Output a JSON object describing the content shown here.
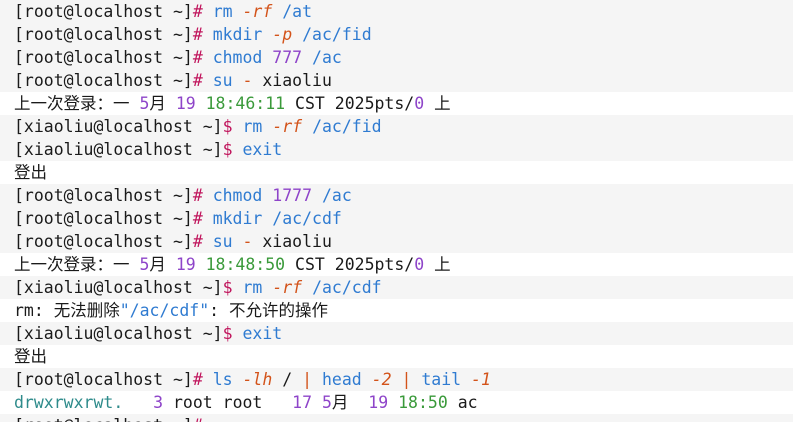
{
  "colors": {
    "background": "#ffffff",
    "prompt_bar": "#f5f5f5",
    "text": "#1a1a1a",
    "prompt_hash": "#c0155c",
    "prompt_dollar": "#c0155c",
    "command": "#2f7bd1",
    "flag": "#d3531a",
    "number": "#8e44c9",
    "time": "#3a9a3a",
    "perm": "#2e8b8b",
    "cursor": "#f2b705"
  },
  "lines": [
    {
      "kind": "cmd",
      "spans": [
        {
          "t": "[root@localhost ~]",
          "c": "text"
        },
        {
          "t": "# ",
          "c": "prompt_hash"
        },
        {
          "t": "rm ",
          "c": "command"
        },
        {
          "t": "-rf ",
          "c": "flag",
          "i": true
        },
        {
          "t": "/at",
          "c": "command"
        }
      ]
    },
    {
      "kind": "cmd",
      "spans": [
        {
          "t": "[root@localhost ~]",
          "c": "text"
        },
        {
          "t": "# ",
          "c": "prompt_hash"
        },
        {
          "t": "mkdir ",
          "c": "command"
        },
        {
          "t": "-p ",
          "c": "flag",
          "i": true
        },
        {
          "t": "/ac/fid",
          "c": "command"
        }
      ]
    },
    {
      "kind": "cmd",
      "spans": [
        {
          "t": "[root@localhost ~]",
          "c": "text"
        },
        {
          "t": "# ",
          "c": "prompt_hash"
        },
        {
          "t": "chmod ",
          "c": "command"
        },
        {
          "t": "777 ",
          "c": "number"
        },
        {
          "t": "/ac",
          "c": "command"
        }
      ]
    },
    {
      "kind": "cmd",
      "spans": [
        {
          "t": "[root@localhost ~]",
          "c": "text"
        },
        {
          "t": "# ",
          "c": "prompt_hash"
        },
        {
          "t": "su ",
          "c": "command"
        },
        {
          "t": "- ",
          "c": "flag"
        },
        {
          "t": "xiaoliu",
          "c": "text"
        }
      ]
    },
    {
      "kind": "out",
      "spans": [
        {
          "t": "上一次登录：一 ",
          "c": "text"
        },
        {
          "t": "5",
          "c": "number"
        },
        {
          "t": "月 ",
          "c": "text"
        },
        {
          "t": "19 ",
          "c": "number"
        },
        {
          "t": "18:46:11 ",
          "c": "time"
        },
        {
          "t": "CST 2025pts/",
          "c": "text"
        },
        {
          "t": "0",
          "c": "number"
        },
        {
          "t": " 上",
          "c": "text"
        }
      ]
    },
    {
      "kind": "cmd",
      "spans": [
        {
          "t": "[xiaoliu@localhost ~]",
          "c": "text"
        },
        {
          "t": "$ ",
          "c": "prompt_dollar"
        },
        {
          "t": "rm ",
          "c": "command"
        },
        {
          "t": "-rf ",
          "c": "flag",
          "i": true
        },
        {
          "t": "/ac/fid",
          "c": "command"
        }
      ]
    },
    {
      "kind": "cmd",
      "spans": [
        {
          "t": "[xiaoliu@localhost ~]",
          "c": "text"
        },
        {
          "t": "$ ",
          "c": "prompt_dollar"
        },
        {
          "t": "exit",
          "c": "command"
        }
      ]
    },
    {
      "kind": "out",
      "spans": [
        {
          "t": "登出",
          "c": "text"
        }
      ]
    },
    {
      "kind": "cmd",
      "spans": [
        {
          "t": "[root@localhost ~]",
          "c": "text"
        },
        {
          "t": "# ",
          "c": "prompt_hash"
        },
        {
          "t": "chmod ",
          "c": "command"
        },
        {
          "t": "1777 ",
          "c": "number"
        },
        {
          "t": "/ac",
          "c": "command"
        }
      ]
    },
    {
      "kind": "cmd",
      "spans": [
        {
          "t": "[root@localhost ~]",
          "c": "text"
        },
        {
          "t": "# ",
          "c": "prompt_hash"
        },
        {
          "t": "mkdir ",
          "c": "command"
        },
        {
          "t": "/ac/cdf",
          "c": "command"
        }
      ]
    },
    {
      "kind": "cmd",
      "spans": [
        {
          "t": "[root@localhost ~]",
          "c": "text"
        },
        {
          "t": "# ",
          "c": "prompt_hash"
        },
        {
          "t": "su ",
          "c": "command"
        },
        {
          "t": "- ",
          "c": "flag"
        },
        {
          "t": "xiaoliu",
          "c": "text"
        }
      ]
    },
    {
      "kind": "out",
      "spans": [
        {
          "t": "上一次登录：一 ",
          "c": "text"
        },
        {
          "t": "5",
          "c": "number"
        },
        {
          "t": "月 ",
          "c": "text"
        },
        {
          "t": "19 ",
          "c": "number"
        },
        {
          "t": "18:48:50 ",
          "c": "time"
        },
        {
          "t": "CST 2025pts/",
          "c": "text"
        },
        {
          "t": "0",
          "c": "number"
        },
        {
          "t": " 上",
          "c": "text"
        }
      ]
    },
    {
      "kind": "cmd",
      "spans": [
        {
          "t": "[xiaoliu@localhost ~]",
          "c": "text"
        },
        {
          "t": "$ ",
          "c": "prompt_dollar"
        },
        {
          "t": "rm ",
          "c": "command"
        },
        {
          "t": "-rf ",
          "c": "flag",
          "i": true
        },
        {
          "t": "/ac/cdf",
          "c": "command"
        }
      ]
    },
    {
      "kind": "out",
      "spans": [
        {
          "t": "rm",
          "c": "text"
        },
        {
          "t": ": 无法删除",
          "c": "text"
        },
        {
          "t": "\"/ac/cdf\"",
          "c": "command"
        },
        {
          "t": ": 不允许的操作",
          "c": "text"
        }
      ]
    },
    {
      "kind": "cmd",
      "spans": [
        {
          "t": "[xiaoliu@localhost ~]",
          "c": "text"
        },
        {
          "t": "$ ",
          "c": "prompt_dollar"
        },
        {
          "t": "exit",
          "c": "command"
        }
      ]
    },
    {
      "kind": "out",
      "spans": [
        {
          "t": "登出",
          "c": "text"
        }
      ]
    },
    {
      "kind": "cmd",
      "spans": [
        {
          "t": "[root@localhost ~]",
          "c": "text"
        },
        {
          "t": "# ",
          "c": "prompt_hash"
        },
        {
          "t": "ls ",
          "c": "command"
        },
        {
          "t": "-lh ",
          "c": "flag",
          "i": true
        },
        {
          "t": "/ ",
          "c": "text"
        },
        {
          "t": "| ",
          "c": "flag"
        },
        {
          "t": "head ",
          "c": "command"
        },
        {
          "t": "-2 ",
          "c": "flag",
          "i": true
        },
        {
          "t": "| ",
          "c": "flag"
        },
        {
          "t": "tail ",
          "c": "command"
        },
        {
          "t": "-1",
          "c": "flag",
          "i": true
        }
      ]
    },
    {
      "kind": "out",
      "spans": [
        {
          "t": "drwxrwxrwt.",
          "c": "perm"
        },
        {
          "t": "   ",
          "c": "text"
        },
        {
          "t": "3",
          "c": "number"
        },
        {
          "t": " root root   ",
          "c": "text"
        },
        {
          "t": "17",
          "c": "number"
        },
        {
          "t": " ",
          "c": "text"
        },
        {
          "t": "5",
          "c": "number"
        },
        {
          "t": "月  ",
          "c": "text"
        },
        {
          "t": "19",
          "c": "number"
        },
        {
          "t": " ",
          "c": "text"
        },
        {
          "t": "18:50",
          "c": "time"
        },
        {
          "t": " ac",
          "c": "text"
        }
      ]
    },
    {
      "kind": "cmd",
      "last": true,
      "spans": [
        {
          "t": "[root@localhost ~]",
          "c": "text"
        },
        {
          "t": "# ",
          "c": "prompt_hash"
        }
      ]
    }
  ]
}
